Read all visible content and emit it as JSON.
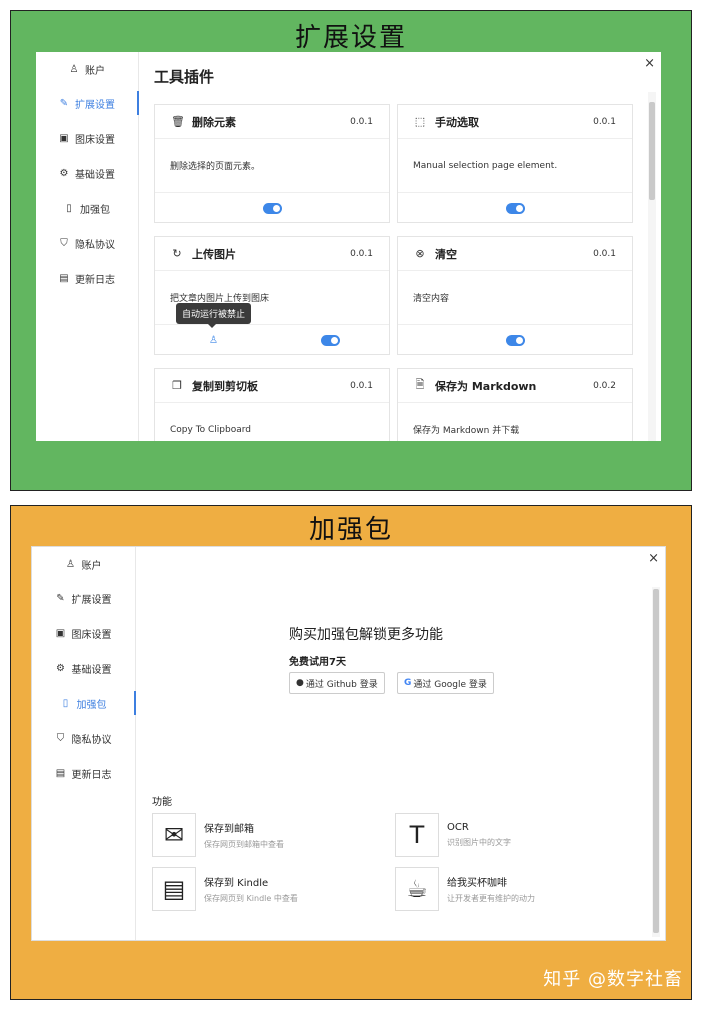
{
  "top_panel": {
    "banner": "扩展设置",
    "close": "×",
    "sidebar": [
      {
        "icon": "user-icon",
        "glyph": "♙",
        "label": "账户",
        "active": false
      },
      {
        "icon": "wrench-icon",
        "glyph": "✎",
        "label": "扩展设置",
        "active": true
      },
      {
        "icon": "image-icon",
        "glyph": "▣",
        "label": "图床设置",
        "active": false
      },
      {
        "icon": "gear-icon",
        "glyph": "⚙",
        "label": "基础设置",
        "active": false
      },
      {
        "icon": "package-icon",
        "glyph": "▯",
        "label": "加强包",
        "active": false
      },
      {
        "icon": "privacy-icon",
        "glyph": "⛉",
        "label": "隐私协议",
        "active": false
      },
      {
        "icon": "log-icon",
        "glyph": "▤",
        "label": "更新日志",
        "active": false
      }
    ],
    "title": "工具插件",
    "cards": [
      {
        "icon": "trash-icon",
        "glyph": "🗑",
        "name": "删除元素",
        "version": "0.0.1",
        "desc": "删除选择的页面元素。",
        "enabled": true
      },
      {
        "icon": "select-icon",
        "glyph": "⬚",
        "name": "手动选取",
        "version": "0.0.1",
        "desc": "Manual selection page element.",
        "enabled": true
      },
      {
        "icon": "refresh-icon",
        "glyph": "↻",
        "name": "上传图片",
        "version": "0.0.1",
        "desc": "把文章内图片上传到图床",
        "enabled": true,
        "tooltip": "自动运行被禁止"
      },
      {
        "icon": "clear-icon",
        "glyph": "⊗",
        "name": "清空",
        "version": "0.0.1",
        "desc": "清空内容",
        "enabled": true
      },
      {
        "icon": "copy-icon",
        "glyph": "❐",
        "name": "复制到剪切板",
        "version": "0.0.1",
        "desc": "Copy To Clipboard",
        "enabled": true
      },
      {
        "icon": "markdown-file-icon",
        "glyph": "🗎",
        "name": "保存为 Markdown",
        "version": "0.0.2",
        "desc": "保存为 Markdown 并下载",
        "enabled": true
      }
    ]
  },
  "bottom_panel": {
    "banner": "加强包",
    "close": "×",
    "sidebar": [
      {
        "icon": "user-icon",
        "glyph": "♙",
        "label": "账户",
        "active": false
      },
      {
        "icon": "wrench-icon",
        "glyph": "✎",
        "label": "扩展设置",
        "active": false
      },
      {
        "icon": "image-icon",
        "glyph": "▣",
        "label": "图床设置",
        "active": false
      },
      {
        "icon": "gear-icon",
        "glyph": "⚙",
        "label": "基础设置",
        "active": false
      },
      {
        "icon": "package-icon",
        "glyph": "▯",
        "label": "加强包",
        "active": true
      },
      {
        "icon": "privacy-icon",
        "glyph": "⛉",
        "label": "隐私协议",
        "active": false
      },
      {
        "icon": "log-icon",
        "glyph": "▤",
        "label": "更新日志",
        "active": false
      }
    ],
    "promo_title": "购买加强包解锁更多功能",
    "trial": "免费试用7天",
    "github_login": "通过 Github 登录",
    "github_glyph": "●",
    "google_login": "通过 Google 登录",
    "google_glyph": "G",
    "features_label": "功能",
    "features": [
      {
        "icon": "mail-icon",
        "glyph": "✉",
        "name": "保存到邮箱",
        "desc": "保存网页到邮箱中查看"
      },
      {
        "icon": "ocr-icon",
        "glyph": "T",
        "name": "OCR",
        "desc": "识别图片中的文字"
      },
      {
        "icon": "kindle-icon",
        "glyph": "▤",
        "name": "保存到 Kindle",
        "desc": "保存网页到 Kindle 中查看"
      },
      {
        "icon": "coffee-icon",
        "glyph": "☕",
        "name": "给我买杯咖啡",
        "desc": "让开发者更有维护的动力"
      }
    ]
  },
  "watermark": "知乎 @数字社畜",
  "colors": {
    "green": "#62b660",
    "orange": "#efae42",
    "accent": "#3d7fe0"
  }
}
